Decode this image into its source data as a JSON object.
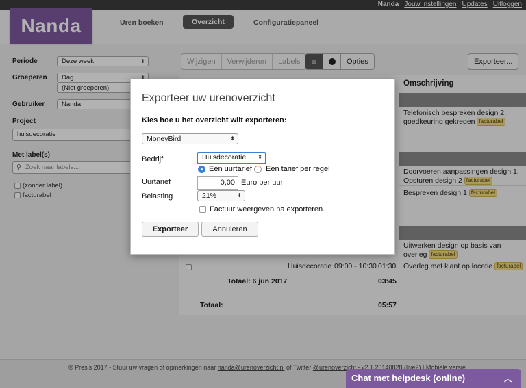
{
  "topbar": {
    "user": "Nanda",
    "links": [
      "Jouw instellingen",
      "Updates",
      "Uitloggen"
    ]
  },
  "header": {
    "logo": "Nanda",
    "nav": [
      "Uren boeken",
      "Overzicht",
      "Configuratiepaneel"
    ],
    "active_nav": "Overzicht"
  },
  "filters": {
    "periode_label": "Periode",
    "periode_value": "Deze week",
    "groeperen_label": "Groeperen",
    "groeperen_value": "Dag",
    "groeperen_value2": "(Niet groeperen)",
    "gebruiker_label": "Gebruiker",
    "gebruiker_value": "Nanda",
    "project_label": "Project",
    "project_value": "huisdecoratie",
    "labels_label": "Met label(s)",
    "labels_placeholder": "Zoek naar labels...",
    "label_options": [
      "(zonder label)",
      "facturabel"
    ]
  },
  "toolbar": {
    "actions": [
      "Wijzigen",
      "Verwijderen",
      "Labels"
    ],
    "options": "Opties",
    "export": "Exporteer..."
  },
  "table": {
    "col_omschrijving": "Omschrijving",
    "rows": [
      {
        "desc": "Telefonisch bespreken design 2; goedkeuring gekregen",
        "badge": "facturabel"
      },
      {
        "desc": "Doorvoeren aanpassingen design 1. Opsturen design 2",
        "badge": "facturabel"
      },
      {
        "desc": "Bespreken design 1",
        "badge": "facturabel"
      },
      {
        "desc": "Uitwerken design op basis van overleg",
        "badge": "facturabel"
      },
      {
        "project": "Huisdecoratie",
        "time": "09:00 - 10:30",
        "duration": "01:30",
        "desc": "Overleg met klant op locatie",
        "badge": "facturabel"
      }
    ],
    "subtotal_label": "Totaal: 6 jun 2017",
    "subtotal_value": "03:45",
    "total_label": "Totaal:",
    "total_value": "05:57"
  },
  "footer": {
    "text_before": "© Presis 2017 - Stuur uw vragen of opmerkingen naar ",
    "email": "nanda@urenoverzicht.nl",
    "text_mid": " of Twitter ",
    "twitter": "@urenoverzicht",
    "text_after": " - v2.1.20140828 (live2) | Mobiele versie"
  },
  "chat": {
    "label": "Chat met helpdesk (online)"
  },
  "dialog": {
    "title": "Exporteer uw urenoverzicht",
    "question": "Kies hoe u het overzicht wilt exporteren:",
    "format_value": "MoneyBird",
    "bedrijf_label": "Bedrijf",
    "bedrijf_value": "Huisdecoratie",
    "radio_1": "Eén uurtarief",
    "radio_2": "Een tarief per regel",
    "uurtarief_label": "Uurtarief",
    "uurtarief_value": "0,00",
    "uurtarief_unit": "Euro per uur",
    "belasting_label": "Belasting",
    "belasting_value": "21%",
    "checkbox_label": "Factuur weergeven na exporteren.",
    "btn_export": "Exporteer",
    "btn_cancel": "Annuleren"
  },
  "colors": {
    "brand": "#7d5a9e",
    "focus": "#3b82d6",
    "badge": "#f3dc8a"
  }
}
